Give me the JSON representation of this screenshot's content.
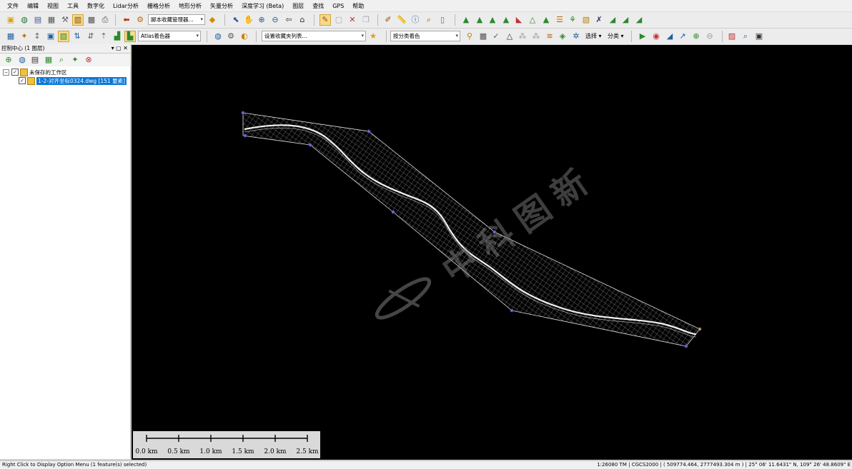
{
  "menu": [
    "文件",
    "编辑",
    "视图",
    "工具",
    "数字化",
    "Lidar分析",
    "栅格分析",
    "地形分析",
    "矢量分析",
    "深度学习 (Beta)",
    "图层",
    "查找",
    "GPS",
    "帮助"
  ],
  "toolbar": {
    "script_manager_combo": "脚本收藏管理器...",
    "atlas_combo": "Atlas着色器",
    "favorites_combo": "设置收藏夹列表...",
    "classify_combo": "按分类着色",
    "select_label": "选择",
    "classify_label": "分类"
  },
  "panel": {
    "title": "控制中心 (1 图层)",
    "workspace_label": "未保存的工作区",
    "layer_label": "1-2-对齐坐标0324.dwg [151 要素]"
  },
  "scalebar": {
    "ticks": [
      "0.0 km",
      "0.5 km",
      "1.0 km",
      "1.5 km",
      "2.0 km",
      "2.5 km"
    ]
  },
  "status": {
    "hint": "Right Click to Display Option Menu (1 feature(s) selected)",
    "scale": "1:26080",
    "projection": "TM",
    "datum": "CGCS2000",
    "coords": "( 509774.464, 2777493.304 m )",
    "latlon": "25° 06' 11.6431\" N, 109° 26' 48.8609\" E"
  },
  "watermark": "中科图新",
  "icons": {
    "open": "folder-open-icon",
    "globe": "globe-icon",
    "save": "save-icon",
    "pan": "pan-hand-icon",
    "zoom_in": "zoom-in-icon",
    "zoom_out": "zoom-out-icon",
    "home": "home-icon"
  },
  "colors": {
    "map_background": "#000000",
    "selection": "#0a78d7",
    "mesh": "#d8d8d8"
  }
}
